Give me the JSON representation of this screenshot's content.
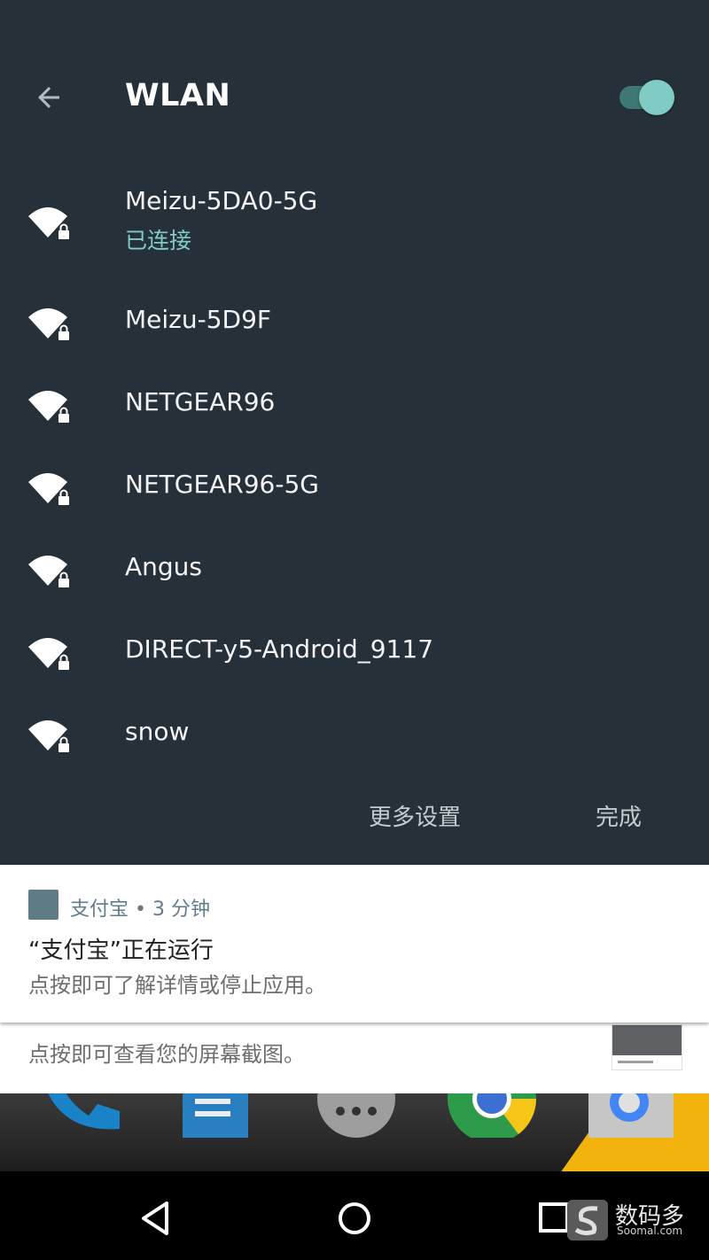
{
  "header": {
    "title": "WLAN",
    "wifi_enabled": true
  },
  "networks": [
    {
      "name": "Meizu-5DA0-5G",
      "status": "已连接",
      "secured": true
    },
    {
      "name": "Meizu-5D9F",
      "secured": true
    },
    {
      "name": "NETGEAR96",
      "secured": true
    },
    {
      "name": "NETGEAR96-5G",
      "secured": true
    },
    {
      "name": "Angus",
      "secured": true
    },
    {
      "name": "DIRECT-y5-Android_9117",
      "secured": true
    },
    {
      "name": "snow",
      "secured": true
    }
  ],
  "actions": {
    "more_settings": "更多设置",
    "done": "完成"
  },
  "notification": {
    "app_name": "支付宝",
    "separator": "•",
    "time": "3 分钟",
    "title": "“支付宝”正在运行",
    "text": "点按即可了解详情或停止应用。"
  },
  "notification2": {
    "text": "点按即可查看您的屏幕截图。"
  },
  "watermark": {
    "text": "数码多",
    "sub": "Soomal.com"
  },
  "colors": {
    "background": "#263039",
    "accent": "#80cbc4",
    "notification_icon": "#5f7b86"
  },
  "icons": {
    "back": "arrow-left-icon",
    "wifi": "wifi-lock-icon",
    "nav_back": "triangle-back-icon",
    "nav_home": "circle-home-icon",
    "nav_recent": "square-recent-icon"
  }
}
